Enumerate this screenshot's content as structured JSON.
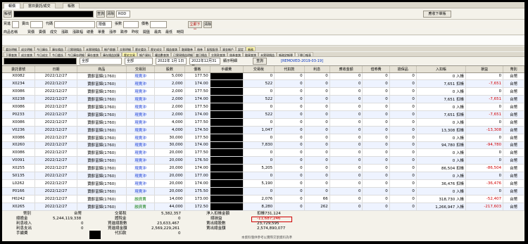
{
  "tabs": [
    "報價",
    "當日委託/成交",
    "帳務"
  ],
  "toolbar": {
    "account_label": "帳號",
    "query_btn": "查詢",
    "clear_btn": "清除",
    "select_value": "ROD",
    "right_btn": "應收下單賬"
  },
  "order_row": {
    "buy_label": "買進",
    "sell_label": "賣出",
    "code_label": "代碼",
    "price_type": "限價",
    "qty_label": "張數",
    "price_label": "價格",
    "submit_btn": "立即下單",
    "cancel_btn": "清除"
  },
  "quote_headers": [
    "商品名稱",
    "買價",
    "賣價",
    "成交",
    "漲跌",
    "漲跌幅",
    "總量",
    "單量",
    "漲停",
    "跌停",
    "昨收",
    "開盤",
    "最高",
    "最低",
    "時間"
  ],
  "subtabs_row1": [
    "委託明細",
    "成交明細",
    "今日庫存",
    "庫存損益",
    "已實現損益",
    "未實現損益",
    "帳戶餘額",
    "交割明細",
    "歷史委託",
    "歷史成交",
    "損益查詢",
    "融資融券",
    "借券",
    "配股配息",
    "資金帳戶",
    "設定",
    "帳務"
  ],
  "subtabs_row2": [
    "下單查詢",
    "成交查詢",
    "今日成交",
    "今日委託",
    "今日庫存明細",
    "庫存查詢",
    "庫存損益試算",
    "歷史交易",
    "帳戶資料",
    "權益數查詢",
    "已實現損益明細",
    "當日損益",
    "交割款查詢",
    "借券查詢",
    "融資查詢",
    "未實現損益",
    "帳務對帳單",
    "下單日報表"
  ],
  "filter": {
    "all1": "全部",
    "all2": "全部",
    "date_from": "2022年 1月 1日",
    "date_to": "2022年12月31日",
    "checkbox": "顯示明細",
    "query_btn": "查詢",
    "link_text": "[REMOVED-2019-03-19]"
  },
  "columns": [
    "委託書號",
    "日期",
    "商品",
    "交易別",
    "股數",
    "價格",
    "手續費",
    "交易稅",
    "代扣款",
    "利息",
    "應收金額",
    "借券費",
    "擔保品",
    "入扣帳",
    "損益",
    "幣別"
  ],
  "rows": [
    {
      "id": "X0082",
      "date": "2022/12/27",
      "product": "寶齡富錦(1760)",
      "type": "現賣沖",
      "qty": "5,000",
      "price": "177.50",
      "fee": "",
      "tax": "0",
      "hold": "0",
      "interest": "0",
      "recv": "0",
      "lend": "0",
      "coll": "0",
      "net": "0 入帳",
      "pl": "0",
      "cur": "台幣"
    },
    {
      "id": "X0234",
      "date": "2022/12/27",
      "product": "寶齡富錦(1760)",
      "type": "現賣沖",
      "qty": "2,000",
      "price": "174.00",
      "fee": "",
      "tax": "522",
      "hold": "0",
      "interest": "0",
      "recv": "0",
      "lend": "0",
      "coll": "0",
      "net": "7,651 扣帳",
      "pl": "-7,651",
      "cur": "台幣"
    },
    {
      "id": "X0086",
      "date": "2022/12/27",
      "product": "寶齡富錦(1760)",
      "type": "現賣沖",
      "qty": "2,000",
      "price": "177.50",
      "fee": "",
      "tax": "0",
      "hold": "0",
      "interest": "0",
      "recv": "0",
      "lend": "0",
      "coll": "0",
      "net": "0 入帳",
      "pl": "0",
      "cur": "台幣"
    },
    {
      "id": "X0238",
      "date": "2022/12/27",
      "product": "寶齡富錦(1760)",
      "type": "現賣沖",
      "qty": "2,000",
      "price": "174.00",
      "fee": "",
      "tax": "522",
      "hold": "0",
      "interest": "0",
      "recv": "0",
      "lend": "0",
      "coll": "0",
      "net": "7,651 扣帳",
      "pl": "-7,651",
      "cur": "台幣"
    },
    {
      "id": "X0086",
      "date": "2022/12/27",
      "product": "寶齡富錦(1760)",
      "type": "現賣沖",
      "qty": "2,000",
      "price": "177.50",
      "fee": "",
      "tax": "0",
      "hold": "0",
      "interest": "0",
      "recv": "0",
      "lend": "0",
      "coll": "0",
      "net": "0 入帳",
      "pl": "0",
      "cur": "台幣"
    },
    {
      "id": "P0233",
      "date": "2022/12/27",
      "product": "寶齡富錦(1760)",
      "type": "現賣沖",
      "qty": "2,000",
      "price": "174.00",
      "fee": "",
      "tax": "522",
      "hold": "0",
      "interest": "0",
      "recv": "0",
      "lend": "0",
      "coll": "0",
      "net": "7,651 扣帳",
      "pl": "-7,651",
      "cur": "台幣"
    },
    {
      "id": "X0086",
      "date": "2022/12/27",
      "product": "寶齡富錦(1760)",
      "type": "現賣沖",
      "qty": "4,000",
      "price": "177.50",
      "fee": "",
      "tax": "0",
      "hold": "0",
      "interest": "0",
      "recv": "0",
      "lend": "0",
      "coll": "0",
      "net": "0 入帳",
      "pl": "0",
      "cur": "台幣"
    },
    {
      "id": "V0236",
      "date": "2022/12/27",
      "product": "寶齡富錦(1760)",
      "type": "現賣沖",
      "qty": "4,000",
      "price": "174.50",
      "fee": "",
      "tax": "1,047",
      "hold": "0",
      "interest": "0",
      "recv": "0",
      "lend": "0",
      "coll": "0",
      "net": "13,308 扣帳",
      "pl": "-13,308",
      "cur": "台幣"
    },
    {
      "id": "X0086",
      "date": "2022/12/27",
      "product": "寶齡富錦(1760)",
      "type": "現賣沖",
      "qty": "30,000",
      "price": "177.50",
      "fee": "",
      "tax": "0",
      "hold": "0",
      "interest": "0",
      "recv": "0",
      "lend": "0",
      "coll": "0",
      "net": "0 入帳",
      "pl": "0",
      "cur": "台幣"
    },
    {
      "id": "X0260",
      "date": "2022/12/27",
      "product": "寶齡富錦(1760)",
      "type": "現賣沖",
      "qty": "30,000",
      "price": "174.00",
      "fee": "",
      "tax": "7,830",
      "hold": "0",
      "interest": "0",
      "recv": "0",
      "lend": "0",
      "coll": "0",
      "net": "94,780 扣帳",
      "pl": "-94,780",
      "cur": "台幣"
    },
    {
      "id": "X0086",
      "date": "2022/12/27",
      "product": "寶齡富錦(1760)",
      "type": "現賣沖",
      "qty": "20,000",
      "price": "177.50",
      "fee": "",
      "tax": "0",
      "hold": "0",
      "interest": "0",
      "recv": "0",
      "lend": "0",
      "coll": "0",
      "net": "0 入帳",
      "pl": "0",
      "cur": "台幣"
    },
    {
      "id": "V0091",
      "date": "2022/12/27",
      "product": "寶齡富錦(1760)",
      "type": "現賣沖",
      "qty": "20,000",
      "price": "176.50",
      "fee": "",
      "tax": "0",
      "hold": "0",
      "interest": "0",
      "recv": "0",
      "lend": "0",
      "coll": "0",
      "net": "0 入帳",
      "pl": "0",
      "cur": "台幣"
    },
    {
      "id": "X0255",
      "date": "2022/12/27",
      "product": "寶齡富錦(1760)",
      "type": "現賣沖",
      "qty": "20,000",
      "price": "174.00",
      "fee": "",
      "tax": "5,205",
      "hold": "0",
      "interest": "0",
      "recv": "0",
      "lend": "0",
      "coll": "0",
      "net": "86,504 扣帳",
      "pl": "-86,504",
      "cur": "台幣"
    },
    {
      "id": "S0135",
      "date": "2022/12/27",
      "product": "寶齡富錦(1760)",
      "type": "現賣沖",
      "qty": "20,000",
      "price": "177.00",
      "fee": "",
      "tax": "0",
      "hold": "0",
      "interest": "0",
      "recv": "0",
      "lend": "0",
      "coll": "0",
      "net": "0 入帳",
      "pl": "0",
      "cur": "台幣"
    },
    {
      "id": "L0262",
      "date": "2022/12/27",
      "product": "寶齡富錦(1760)",
      "type": "現賣沖",
      "qty": "20,000",
      "price": "174.00",
      "fee": "",
      "tax": "5,190",
      "hold": "0",
      "interest": "0",
      "recv": "0",
      "lend": "0",
      "coll": "0",
      "net": "36,476 扣帳",
      "pl": "-36,476",
      "cur": "台幣"
    },
    {
      "id": "P0166",
      "date": "2022/12/27",
      "product": "寶齡富錦(1760)",
      "type": "現賣沖",
      "qty": "20,000",
      "price": "175.50",
      "fee": "",
      "tax": "0",
      "hold": "0",
      "interest": "0",
      "recv": "0",
      "lend": "0",
      "coll": "0",
      "net": "0 入帳",
      "pl": "0",
      "cur": "台幣"
    },
    {
      "id": "H0242",
      "date": "2022/12/27",
      "product": "寶齡富錦(1760)",
      "type": "融資賣",
      "qty": "14,000",
      "price": "173.00",
      "fee": "",
      "tax": "2,076",
      "hold": "0",
      "interest": "66",
      "recv": "0",
      "lend": "0",
      "coll": "0",
      "net": "318,730 入帳",
      "pl": "-52,407",
      "cur": "台幣"
    },
    {
      "id": "X0265",
      "date": "2022/12/27",
      "product": "寶齡富錦(1760)",
      "type": "融資賣",
      "qty": "44,000",
      "price": "172.50",
      "fee": "",
      "tax": "8,280",
      "hold": "0",
      "interest": "262",
      "recv": "0",
      "lend": "0",
      "coll": "0",
      "net": "1,266,947 入帳",
      "pl": "-217,603",
      "cur": "台幣"
    }
  ],
  "footer": {
    "col1": [
      "幣別",
      "總擔金",
      "利息收入",
      "利息支出",
      "手續費"
    ],
    "col1_vals": [
      "台幣",
      "5,244,119,338",
      "0",
      "0",
      ""
    ],
    "col2": [
      "交易稅",
      "證稅金",
      "買進總股數",
      "買進總金額",
      "代扣款"
    ],
    "col2_vals": [
      "5,382,357",
      "0",
      "23,633,467",
      "2,569,229,261",
      "0"
    ],
    "col3": [
      "淨入扣帳金額",
      "總損益",
      "賣出總股數",
      "賣出總金額"
    ],
    "col3_vals": [
      "扣帳731,124",
      "-11,687,246",
      "23,729,595",
      "2,574,890,077"
    ],
    "note": "本資料僅供參考以實際交割資料為準"
  }
}
